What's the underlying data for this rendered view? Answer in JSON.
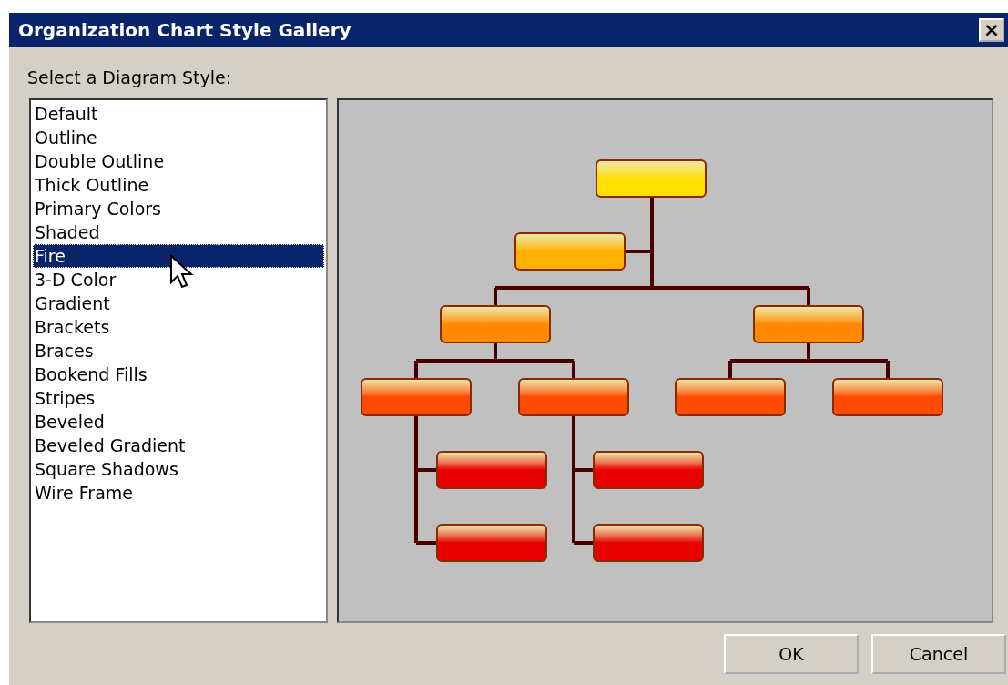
{
  "window": {
    "title": "Organization Chart Style Gallery",
    "close": "×"
  },
  "prompt": "Select a Diagram Style:",
  "styles": [
    {
      "label": "Default",
      "selected": false
    },
    {
      "label": "Outline",
      "selected": false
    },
    {
      "label": "Double Outline",
      "selected": false
    },
    {
      "label": "Thick Outline",
      "selected": false
    },
    {
      "label": "Primary Colors",
      "selected": false
    },
    {
      "label": "Shaded",
      "selected": false
    },
    {
      "label": "Fire",
      "selected": true
    },
    {
      "label": "3-D Color",
      "selected": false
    },
    {
      "label": "Gradient",
      "selected": false
    },
    {
      "label": "Brackets",
      "selected": false
    },
    {
      "label": "Braces",
      "selected": false
    },
    {
      "label": "Bookend Fills",
      "selected": false
    },
    {
      "label": "Stripes",
      "selected": false
    },
    {
      "label": "Beveled",
      "selected": false
    },
    {
      "label": "Beveled Gradient",
      "selected": false
    },
    {
      "label": "Square Shadows",
      "selected": false
    },
    {
      "label": "Wire Frame",
      "selected": false
    }
  ],
  "buttons": [
    "OK",
    "Cancel"
  ]
}
